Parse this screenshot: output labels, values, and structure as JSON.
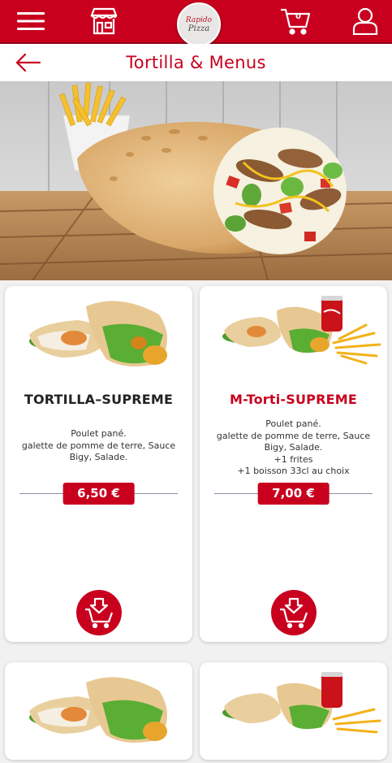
{
  "header": {
    "logo_line1": "Rapido",
    "logo_line2": "Pizza",
    "cart_count": "0"
  },
  "titlebar": {
    "title": "Tortilla & Menus"
  },
  "products": [
    {
      "name": "TORTILLA–SUPREME",
      "desc": [
        "Poulet pané.",
        "galette de pomme de terre, Sauce",
        "Bigy, Salade."
      ],
      "price": "6,50 €"
    },
    {
      "name": "M-Torti-SUPREME",
      "desc": [
        "Poulet pané.",
        "galette de pomme de terre, Sauce",
        "Bigy, Salade.",
        "+1 frites",
        "+1 boisson 33cl au choix"
      ],
      "price": "7,00 €"
    }
  ],
  "colors": {
    "brand": "#c8001e",
    "background": "#f1f1f1"
  }
}
